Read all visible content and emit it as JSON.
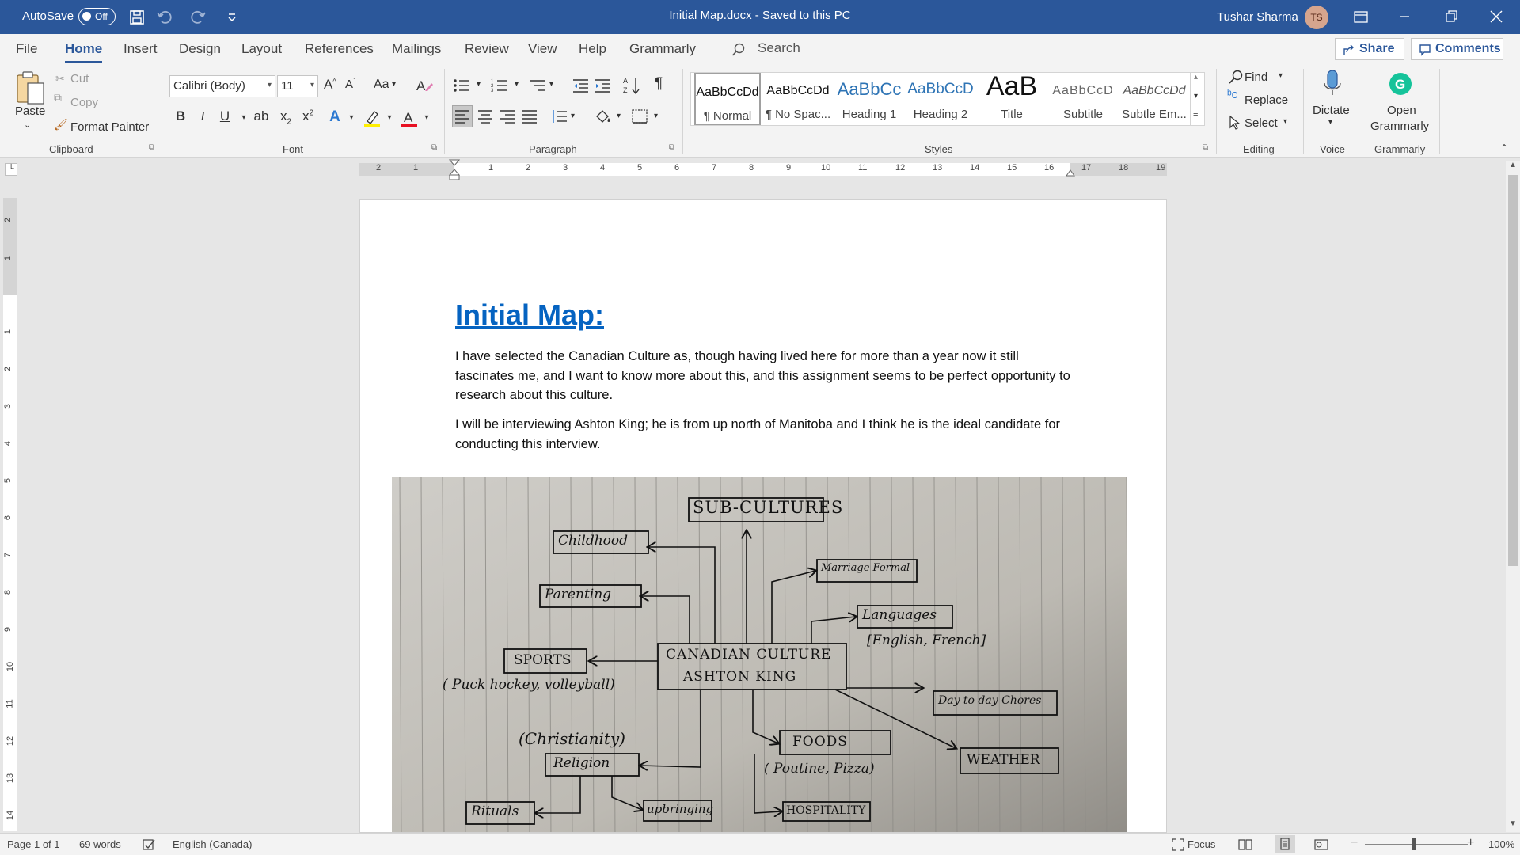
{
  "titlebar": {
    "autosave_label": "AutoSave",
    "autosave_state": "Off",
    "document_title": "Initial Map.docx  -  Saved to this PC",
    "user_name": "Tushar Sharma",
    "user_initials": "TS"
  },
  "tabs": [
    "File",
    "Home",
    "Insert",
    "Design",
    "Layout",
    "References",
    "Mailings",
    "Review",
    "View",
    "Help",
    "Grammarly"
  ],
  "active_tab": "Home",
  "search_label": "Search",
  "share_label": "Share",
  "comments_label": "Comments",
  "ribbon": {
    "clipboard": {
      "label": "Clipboard",
      "paste": "Paste",
      "cut": "Cut",
      "copy": "Copy",
      "format_painter": "Format Painter"
    },
    "font": {
      "label": "Font",
      "font_name": "Calibri (Body)",
      "font_size": "11",
      "change_case": "Aa"
    },
    "paragraph": {
      "label": "Paragraph"
    },
    "styles": {
      "label": "Styles",
      "items": [
        {
          "sample": "AaBbCcDd",
          "name": "¶ Normal"
        },
        {
          "sample": "AaBbCcDd",
          "name": "¶ No Spac..."
        },
        {
          "sample": "AaBbCc",
          "name": "Heading 1"
        },
        {
          "sample": "AaBbCcD",
          "name": "Heading 2"
        },
        {
          "sample": "AaB",
          "name": "Title"
        },
        {
          "sample": "AaBbCcD",
          "name": "Subtitle"
        },
        {
          "sample": "AaBbCcDd",
          "name": "Subtle Em..."
        }
      ]
    },
    "editing": {
      "label": "Editing",
      "find": "Find",
      "replace": "Replace",
      "select": "Select"
    },
    "voice": {
      "label": "Voice",
      "dictate": "Dictate"
    },
    "grammarly": {
      "label": "Grammarly",
      "open_line1": "Open",
      "open_line2": "Grammarly"
    }
  },
  "ruler": {
    "h_ticks": [
      "2",
      "1",
      "1",
      "2",
      "3",
      "4",
      "5",
      "6",
      "7",
      "8",
      "9",
      "10",
      "11",
      "12",
      "13",
      "14",
      "15",
      "16",
      "17",
      "18",
      "19"
    ],
    "v_ticks": [
      "2",
      "1",
      "1",
      "2",
      "3",
      "4",
      "5",
      "6",
      "7",
      "8",
      "9",
      "10",
      "11",
      "12",
      "13",
      "14"
    ]
  },
  "document": {
    "heading": "Initial Map:",
    "paragraph1": "I have selected the Canadian Culture as, though having lived here for more than a year now it still fascinates me, and I want to know more about this, and this assignment seems to be perfect opportunity to research about this culture.",
    "paragraph2": "I will be interviewing Ashton King; he is from up north of Manitoba and I think he is the ideal candidate for conducting this interview.",
    "sketch": {
      "center_line1": "CANADIAN CULTURE",
      "center_line2": "ASHTON KING",
      "nodes": [
        "SUB-CULTURES",
        "Childhood",
        "Parenting",
        "Marriage Formal",
        "Languages",
        "[English, French]",
        "SPORTS",
        "( Puck hockey, volleyball)",
        "Day to day Chores",
        "(Christianity)",
        "Religion",
        "FOODS",
        "WEATHER",
        "( Poutine, Pizza)",
        "Rituals",
        "upbringing",
        "HOSPITALITY"
      ]
    }
  },
  "statusbar": {
    "page": "Page 1 of 1",
    "words": "69 words",
    "language": "English (Canada)",
    "focus": "Focus",
    "zoom": "100%"
  }
}
